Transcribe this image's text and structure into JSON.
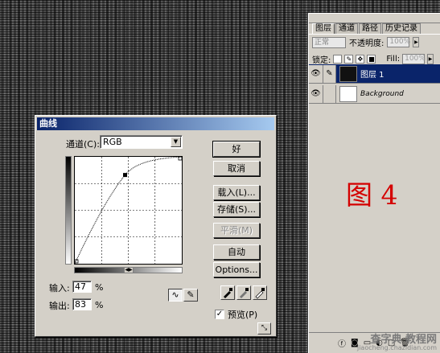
{
  "curves_dialog": {
    "title": "曲线",
    "channel_label": "通道(C):",
    "channel_value": "RGB",
    "input_label": "输入:",
    "input_value": "47",
    "output_label": "输出:",
    "output_value": "83",
    "percent": "%",
    "buttons": {
      "ok": "好",
      "cancel": "取消",
      "load": "载入(L)...",
      "save": "存储(S)...",
      "smooth": "平滑(M)",
      "auto": "自动",
      "options": "Options..."
    },
    "preview_label": "预览(P)",
    "preview_checked": "✓",
    "curve": {
      "input_percent": 47,
      "output_percent": 83,
      "shape": "convex-up"
    }
  },
  "layers_panel": {
    "tabs": [
      "图层",
      "通道",
      "路径",
      "历史记录"
    ],
    "blend_mode": "正常",
    "opacity_label": "不透明度:",
    "opacity_value": "100%",
    "lock_label": "锁定:",
    "fill_label": "Fill:",
    "fill_value": "100%",
    "layers": [
      {
        "name": "图层 1",
        "selected": true,
        "thumb_color": "#111111"
      },
      {
        "name": "Background",
        "selected": false,
        "thumb_color": "#ffffff"
      }
    ]
  },
  "figure_label": "图 4",
  "watermark": {
    "line1": "查字典 教程网",
    "line2": "jiaocheng.chazidian.com"
  }
}
